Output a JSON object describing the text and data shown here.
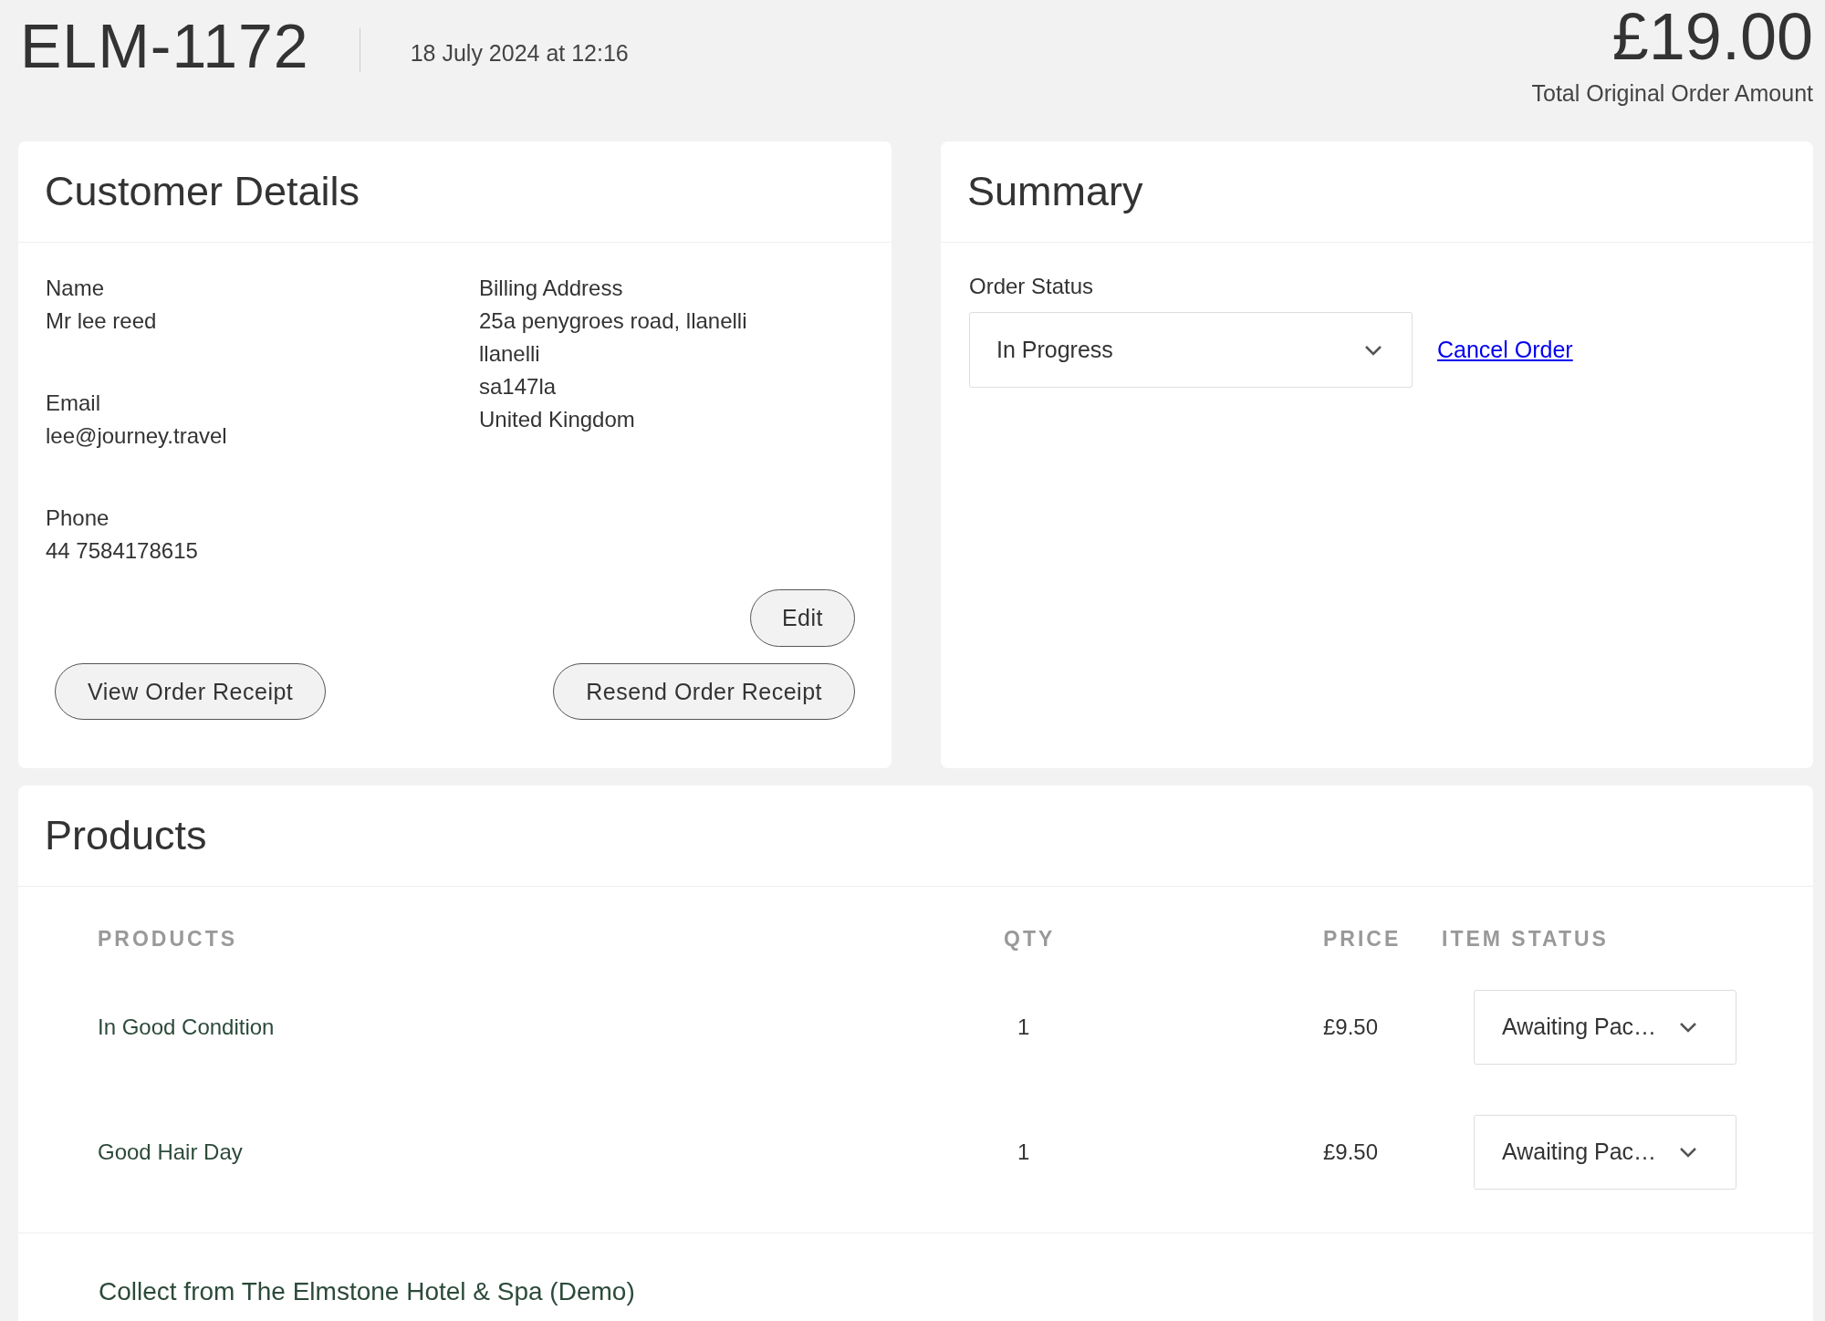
{
  "order": {
    "number": "ELM-1172",
    "date": "18 July 2024 at 12:16",
    "total": "£19.00",
    "total_label": "Total Original Order Amount"
  },
  "customer": {
    "title": "Customer Details",
    "fields": [
      {
        "label": "Name",
        "value": "Mr lee reed"
      },
      {
        "label": "Email",
        "value": "lee@journey.travel"
      },
      {
        "label": "Phone",
        "value": "44 7584178615"
      }
    ],
    "billing": {
      "label": "Billing Address",
      "lines": [
        "25a penygroes road, llanelli",
        "llanelli",
        "sa147la",
        "United Kingdom"
      ]
    },
    "edit_button": "Edit",
    "view_button": "View Order Receipt",
    "resend_button": "Resend Order Receipt"
  },
  "summary": {
    "title": "Summary",
    "status_label": "Order Status",
    "status_value": "In Progress",
    "cancel_link": "Cancel Order"
  },
  "products": {
    "title": "Products",
    "columns": [
      "PRODUCTS",
      "QTY",
      "PRICE",
      "ITEM STATUS"
    ],
    "rows": [
      {
        "name": "In Good Condition",
        "qty": "1",
        "price": "£9.50",
        "status": "Awaiting Pac…"
      },
      {
        "name": "Good Hair Day",
        "qty": "1",
        "price": "£9.50",
        "status": "Awaiting Pac…"
      }
    ],
    "collection": "Collect from The Elmstone Hotel & Spa (Demo)"
  }
}
